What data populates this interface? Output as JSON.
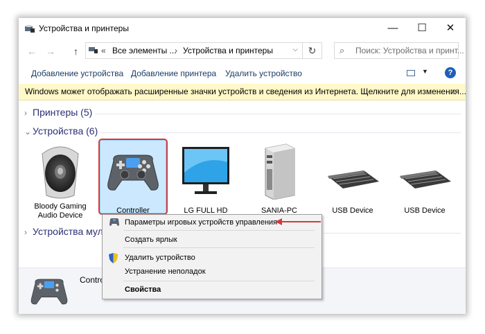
{
  "window": {
    "title": "Устройства и принтеры",
    "controls": {
      "minimize": "—",
      "maximize": "☐",
      "close": "✕"
    }
  },
  "address": {
    "back": "←",
    "forward": "→",
    "up": "↑",
    "overflow": "«",
    "crumbs": [
      "Все элементы ...",
      "Устройства и принтеры"
    ],
    "separator": "›",
    "dropdown": "⌵",
    "refresh": "↻",
    "search_placeholder": "Поиск: Устройства и принт..."
  },
  "toolbar": {
    "add_device": "Добавление устройства",
    "add_printer": "Добавление принтера",
    "remove_device": "Удалить устройство",
    "view_dropdown": "▼",
    "help": "?"
  },
  "infobar": {
    "text": "Windows может отображать расширенные значки устройств и сведения из Интернета.  Щелкните для изменения...",
    "close": "x"
  },
  "groups": [
    {
      "chevron": "›",
      "label": "Принтеры (5)"
    },
    {
      "chevron": "⌄",
      "label": "Устройства (6)"
    },
    {
      "chevron": "›",
      "label": "Устройства мульт..."
    }
  ],
  "devices": [
    {
      "label": "Bloody Gaming Audio Device",
      "icon": "speaker-icon"
    },
    {
      "label": "Controller",
      "icon": "gamepad-icon",
      "selected": true
    },
    {
      "label": "LG FULL HD",
      "icon": "monitor-icon"
    },
    {
      "label": "SANIA-PC",
      "icon": "computer-tower-icon"
    },
    {
      "label": "USB Device",
      "icon": "keyboard-icon"
    },
    {
      "label": "USB Device",
      "icon": "keyboard-icon"
    }
  ],
  "details": {
    "name": "Contro"
  },
  "context_menu": {
    "items": [
      {
        "label": "Параметры игровых устройств управления",
        "icon": "gamepad-icon"
      },
      {
        "label": "Создать ярлык"
      },
      {
        "label": "Удалить устройство",
        "icon": "shield-icon"
      },
      {
        "label": "Устранение неполадок"
      },
      {
        "label": "Свойства",
        "bold": true
      }
    ]
  },
  "colors": {
    "selection_fill": "#cce8ff",
    "selection_border": "#99d1ff",
    "highlight_red": "#d33a3a",
    "link_text": "#1a3a66",
    "group_text": "#2a2f74",
    "infobar_bg": "#fff8c8"
  }
}
